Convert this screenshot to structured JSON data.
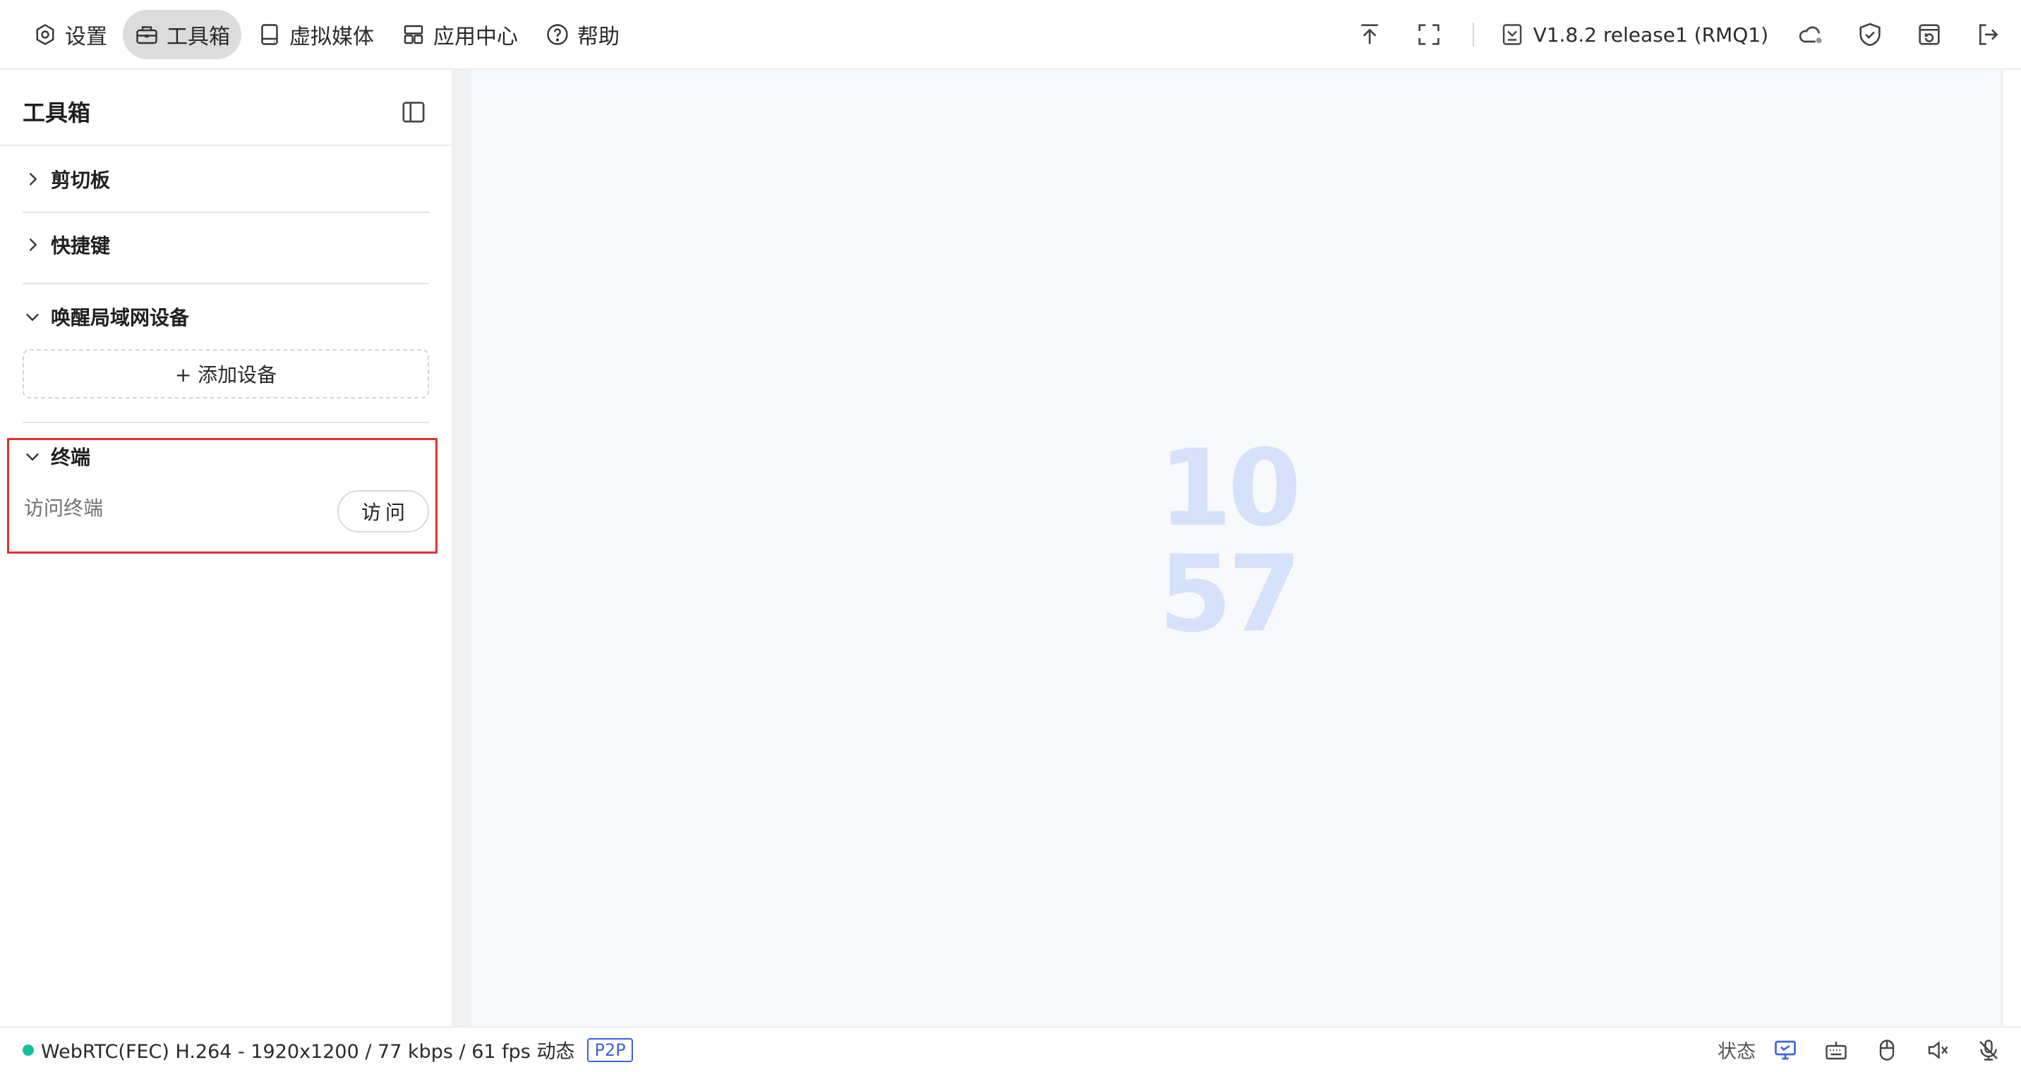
{
  "nav": {
    "items": [
      {
        "label": "设置",
        "icon": "settings-icon"
      },
      {
        "label": "工具箱",
        "icon": "toolbox-icon",
        "active": true
      },
      {
        "label": "虚拟媒体",
        "icon": "storage-icon"
      },
      {
        "label": "应用中心",
        "icon": "apps-icon"
      },
      {
        "label": "帮助",
        "icon": "help-icon"
      }
    ]
  },
  "topbar": {
    "version": "V1.8.2 release1 (RMQ1)"
  },
  "sidebar": {
    "title": "工具箱",
    "sections": [
      {
        "label": "剪切板",
        "expanded": false
      },
      {
        "label": "快捷键",
        "expanded": false
      },
      {
        "label": "唤醒局域网设备",
        "expanded": true
      },
      {
        "label": "终端",
        "expanded": true
      }
    ],
    "add_device_label": "+ 添加设备",
    "terminal": {
      "label": "访问终端",
      "button": "访问"
    }
  },
  "main": {
    "clock": {
      "hour": "10",
      "minute": "57"
    }
  },
  "statusbar": {
    "stream_info": "WebRTC(FEC) H.264 - 1920x1200 /  77 kbps / 61 fps 动态",
    "p2p_badge": "P2P",
    "status_label": "状态"
  },
  "colors": {
    "accent": "#3b63e0",
    "online": "#12c29a",
    "highlight_border": "#e03131",
    "clock": "#d6e1fb"
  }
}
